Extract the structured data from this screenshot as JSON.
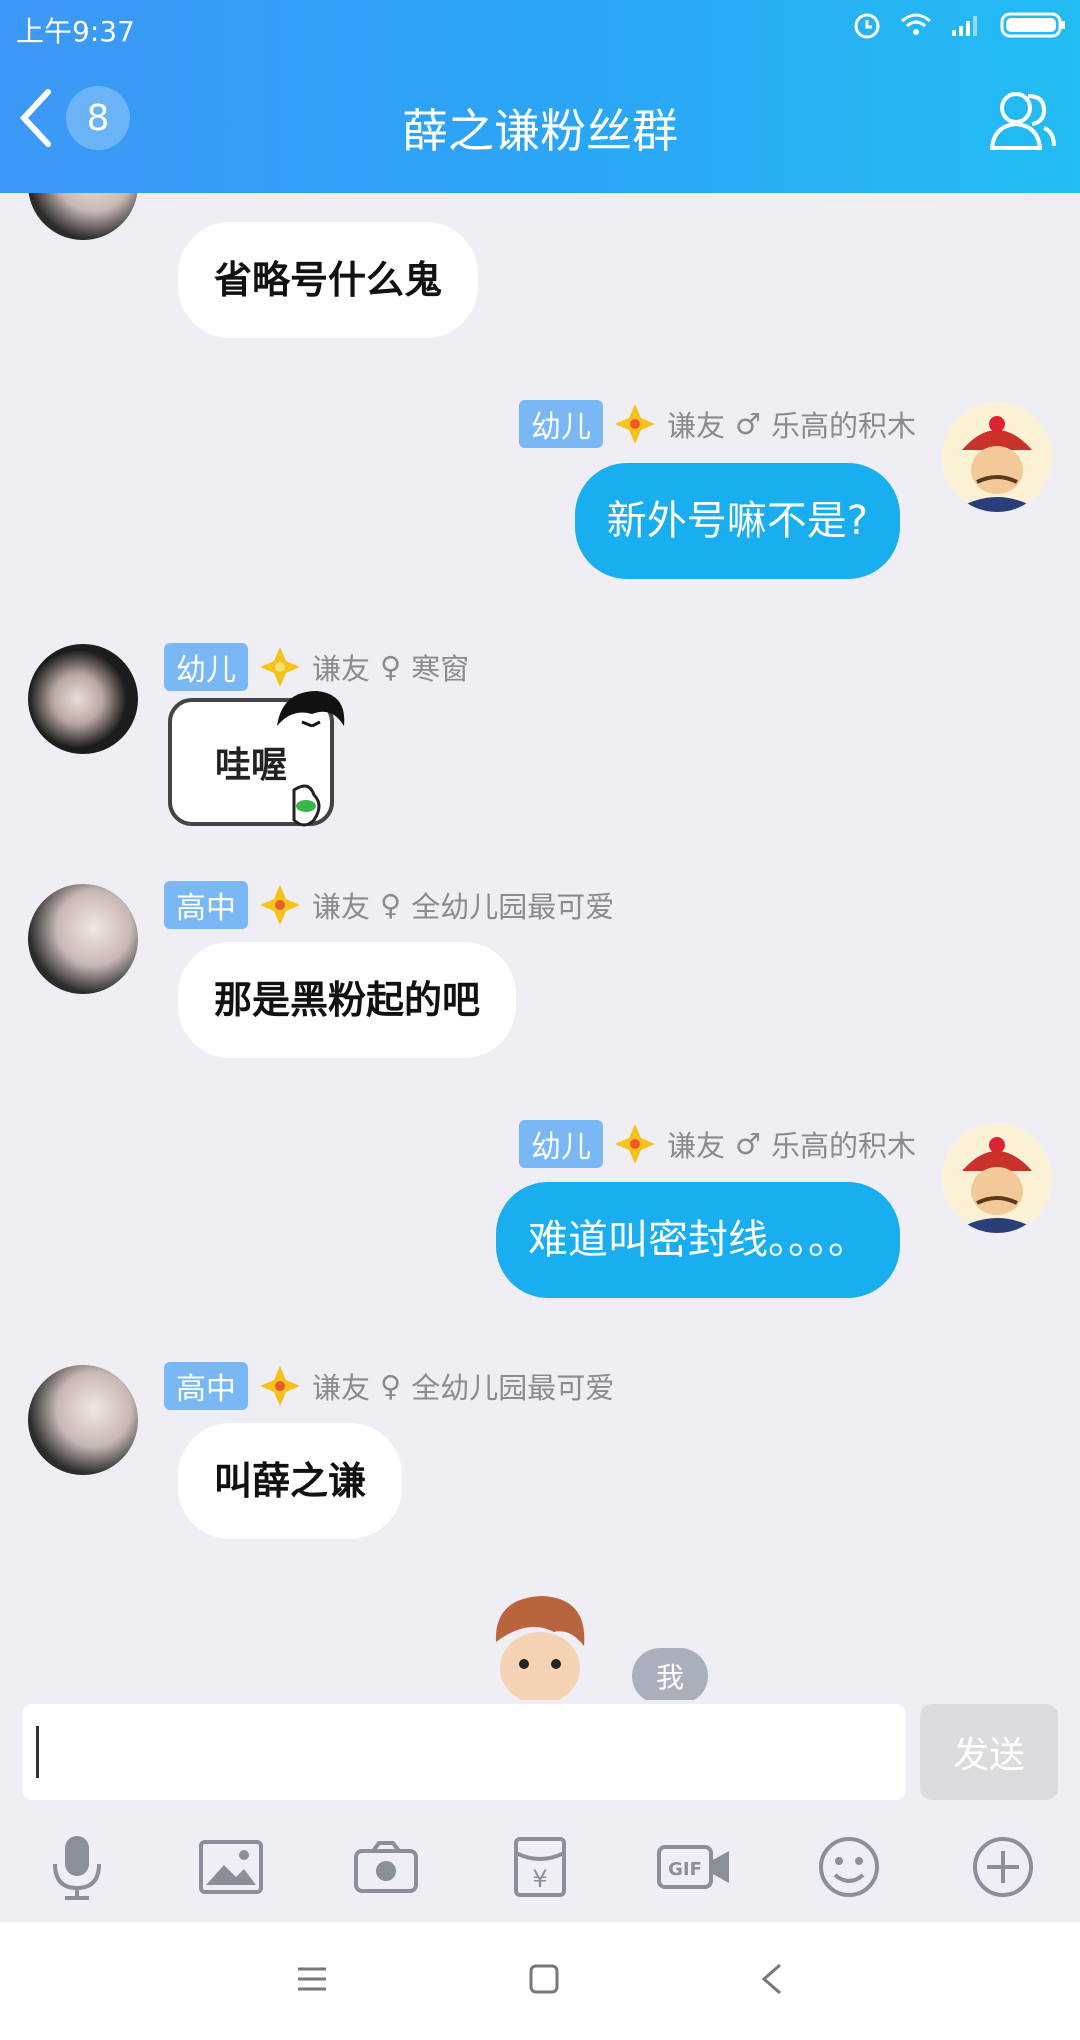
{
  "status": {
    "time": "上午9:37"
  },
  "header": {
    "back_count": "8",
    "title": "薛之谦粉丝群"
  },
  "messages": [
    {
      "side": "left",
      "text": "省略号什么鬼"
    },
    {
      "side": "right",
      "level": "幼儿",
      "role": "谦友",
      "gender": "♂",
      "name": "乐高的积木",
      "text": "新外号嘛不是?"
    },
    {
      "side": "left",
      "level": "幼儿",
      "role": "谦友",
      "gender": "♀",
      "name": "寒窗",
      "text": "哇喔"
    },
    {
      "side": "left",
      "level": "高中",
      "role": "谦友",
      "gender": "♀",
      "name": "全幼儿园最可爱",
      "text": "那是黑粉起的吧"
    },
    {
      "side": "right",
      "level": "幼儿",
      "role": "谦友",
      "gender": "♂",
      "name": "乐高的积木",
      "text": "难道叫密封线。。。。"
    },
    {
      "side": "left",
      "level": "高中",
      "role": "谦友",
      "gender": "♀",
      "name": "全幼儿园最可爱",
      "text": "叫薛之谦"
    }
  ],
  "self_tag": "我",
  "input": {
    "value": "",
    "send_label": "发送"
  },
  "toolbar": [
    "mic-icon",
    "image-icon",
    "camera-icon",
    "red-packet-icon",
    "gif-icon",
    "emoji-icon",
    "plus-icon"
  ],
  "colors": {
    "header_start": "#3d98f5",
    "header_end": "#22bdf3",
    "bubble_self": "#18aef0",
    "badge": "#7ab8f5"
  }
}
